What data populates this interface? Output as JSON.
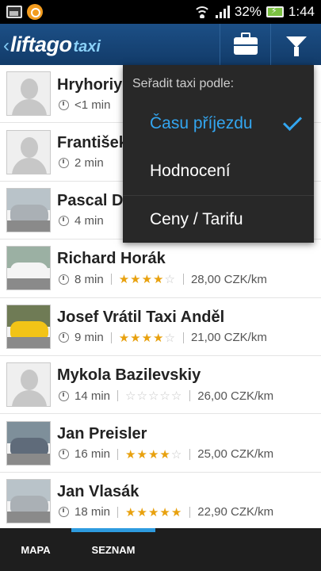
{
  "status_bar": {
    "battery_percent": "32%",
    "time": "1:44"
  },
  "app_bar": {
    "logo_brand": "liftago",
    "logo_sub": "taxi",
    "actions": [
      "briefcase-icon",
      "filter-icon"
    ]
  },
  "sort_menu": {
    "title": "Seřadit taxi podle:",
    "options": [
      {
        "label": "Času příjezdu",
        "selected": true
      },
      {
        "label": "Hodnocení",
        "selected": false
      },
      {
        "label": "Ceny / Tarifu",
        "selected": false
      }
    ],
    "accent_color": "#33a6f0"
  },
  "drivers": [
    {
      "name": "Hryhoriy",
      "eta": "<1 min",
      "rating": null,
      "price": "",
      "photo": "placeholder"
    },
    {
      "name": "František",
      "eta": "2 min",
      "rating": null,
      "price": "",
      "photo": "placeholder"
    },
    {
      "name": "Pascal D",
      "eta": "4 min",
      "rating": null,
      "price": "",
      "photo": "car-silver"
    },
    {
      "name": "Richard Horák",
      "eta": "8 min",
      "rating": 4,
      "price": "28,00 CZK/km",
      "photo": "car-white"
    },
    {
      "name": "Josef Vrátil Taxi Anděl",
      "eta": "9 min",
      "rating": 4,
      "price": "21,00 CZK/km",
      "photo": "car-yellow"
    },
    {
      "name": "Mykola Bazilevskiy",
      "eta": "14 min",
      "rating": 0,
      "price": "26,00 CZK/km",
      "photo": "placeholder"
    },
    {
      "name": "Jan Preisler",
      "eta": "16 min",
      "rating": 4,
      "price": "25,00 CZK/km",
      "photo": "car-gray"
    },
    {
      "name": "Jan Vlasák",
      "eta": "18 min",
      "rating": 5,
      "price": "22,90 CZK/km",
      "photo": "car-silver"
    }
  ],
  "tabs": [
    {
      "label": "MAPA",
      "active": false
    },
    {
      "label": "SEZNAM",
      "active": true
    }
  ],
  "colors": {
    "app_bar": "#1c4f86",
    "star": "#e8a10e",
    "tab_indicator": "#2e9bdf"
  }
}
